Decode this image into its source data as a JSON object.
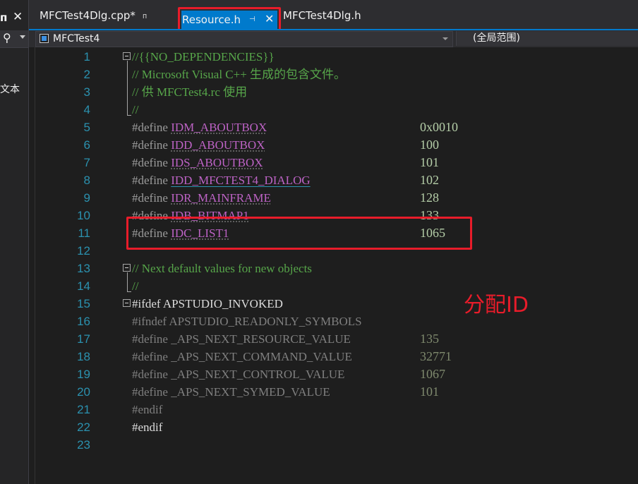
{
  "left_panel": {
    "fragment_text": "文本"
  },
  "tabs": [
    {
      "label": "MFCTest4Dlg.cpp*",
      "active": false
    },
    {
      "label": "Resource.h",
      "active": true
    },
    {
      "label": "MFCTest4Dlg.h",
      "active": false
    }
  ],
  "nav": {
    "project": "MFCTest4",
    "scope": "(全局范围)"
  },
  "code_lines": [
    {
      "n": "1",
      "text": "//{{NO_DEPENDENCIES}}"
    },
    {
      "n": "2",
      "text": "// Microsoft Visual C++ 生成的包含文件。"
    },
    {
      "n": "3",
      "text": "// 供 MFCTest4.rc 使用"
    },
    {
      "n": "4",
      "text": "//"
    },
    {
      "n": "5",
      "kw": "#define",
      "name": "IDM_ABOUTBOX",
      "value": "0x0010"
    },
    {
      "n": "6",
      "kw": "#define",
      "name": "IDD_ABOUTBOX",
      "value": "100"
    },
    {
      "n": "7",
      "kw": "#define",
      "name": "IDS_ABOUTBOX",
      "value": "101"
    },
    {
      "n": "8",
      "kw": "#define",
      "name": "IDD_MFCTEST4_DIALOG",
      "value": "102"
    },
    {
      "n": "9",
      "kw": "#define",
      "name": "IDR_MAINFRAME",
      "value": "128"
    },
    {
      "n": "10",
      "kw": "#define",
      "name": "IDB_BITMAP1",
      "value": "133"
    },
    {
      "n": "11",
      "kw": "#define",
      "name": "IDC_LIST1",
      "value": "1065"
    },
    {
      "n": "12",
      "text": ""
    },
    {
      "n": "13",
      "text": "// Next default values for new objects"
    },
    {
      "n": "14",
      "text": "//"
    },
    {
      "n": "15",
      "kw": "#ifdef",
      "name": "APSTUDIO_INVOKED"
    },
    {
      "n": "16",
      "kw": "#ifndef",
      "name": "APSTUDIO_READONLY_SYMBOLS"
    },
    {
      "n": "17",
      "kw": "#define",
      "name": "_APS_NEXT_RESOURCE_VALUE",
      "value": "135"
    },
    {
      "n": "18",
      "kw": "#define",
      "name": "_APS_NEXT_COMMAND_VALUE",
      "value": "32771"
    },
    {
      "n": "19",
      "kw": "#define",
      "name": "_APS_NEXT_CONTROL_VALUE",
      "value": "1067"
    },
    {
      "n": "20",
      "kw": "#define",
      "name": "_APS_NEXT_SYMED_VALUE",
      "value": "101"
    },
    {
      "n": "21",
      "kw": "#endif"
    },
    {
      "n": "22",
      "kw": "#endif"
    },
    {
      "n": "23",
      "text": ""
    }
  ],
  "annotation": "分配ID",
  "colors": {
    "background": "#1e1e1e",
    "line_number": "#2b91af",
    "comment": "#57a64a",
    "macro": "#bd63c5",
    "number": "#b5cea8",
    "active_tab": "#007acc",
    "highlight_red": "#e81c2a"
  }
}
